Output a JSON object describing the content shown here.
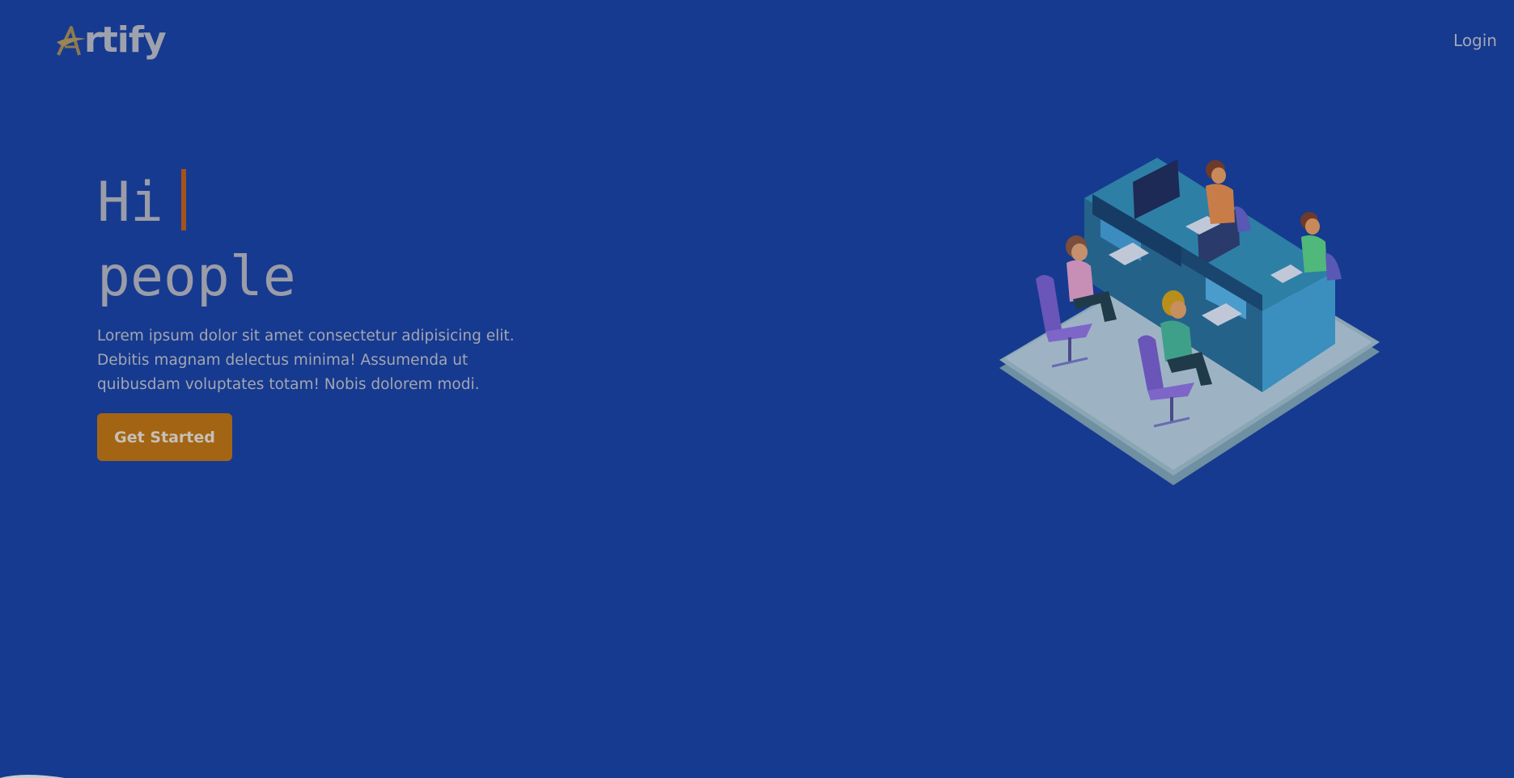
{
  "nav": {
    "logo_mark": "A",
    "logo_text": "rtify",
    "login_label": "Login"
  },
  "hero": {
    "headline_line1": "Hi",
    "headline_line2": "people",
    "description": "Lorem ipsum dolor sit amet consectetur adipisicing elit. Debitis magnam delectus minima! Assumenda ut quibusdam voluptates totam! Nobis dolorem modi.",
    "cta_label": "Get Started"
  },
  "illustration": {
    "icon": "office-workstation-illustration"
  },
  "colors": {
    "background": "#163a8f",
    "accent": "#a36513",
    "cursor": "#a3531c",
    "text": "#a3a6b2"
  }
}
